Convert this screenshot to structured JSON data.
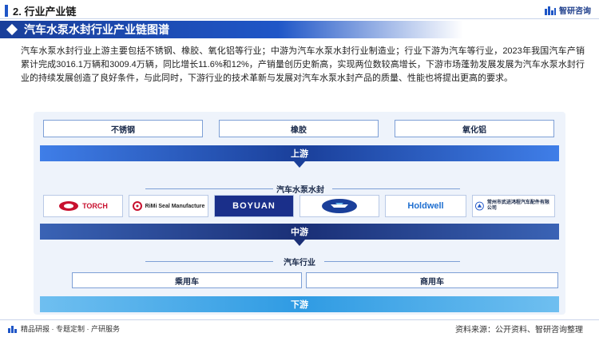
{
  "header": {
    "section": "2. 行业产业链",
    "brand": "智研咨询"
  },
  "title": "汽车水泵水封行业产业链图谱",
  "intro": "汽车水泵水封行业上游主要包括不锈钢、橡胶、氧化铝等行业；中游为汽车水泵水封行业制造业；行业下游为汽车等行业，2023年我国汽车产销累计完成3016.1万辆和3009.4万辆，同比增长11.6%和12%，产销量创历史新高，实现两位数较高增长，下游市场蓬勃发展发展为汽车水泵水封行业的持续发展创造了良好条件，与此同时，下游行业的技术革新与发展对汽车水泵水封产品的质量、性能也将提出更高的要求。",
  "upstream": {
    "materials": [
      "不锈钢",
      "橡胶",
      "氧化铝"
    ],
    "stage_label": "上游"
  },
  "midstream": {
    "sub_label": "汽车水泵水封",
    "companies": [
      {
        "text": "TORCH",
        "color": "#c8102e"
      },
      {
        "text": "RiMi Seal Manufacture",
        "color": "#222222"
      },
      {
        "text": "BOYUAN",
        "color": "#ffffff"
      },
      {
        "text": "",
        "color": "#1f56c7"
      },
      {
        "text": "Holdwell",
        "color": "#1f6fd0"
      },
      {
        "text": "常州市武进鸿程汽车配件有限公司",
        "color": "#1a2a4a"
      }
    ],
    "stage_label": "中游"
  },
  "downstream": {
    "sub_label": "汽车行业",
    "industries": [
      "乘用车",
      "商用车"
    ],
    "stage_label": "下游"
  },
  "footer": {
    "tags": "精品研报 · 专题定制 · 产研服务",
    "source": "资料来源：公开资料、智研咨询整理"
  },
  "colors": {
    "primary": "#1f56c7",
    "dark": "#1a3f9a",
    "light_bg": "#eef3fb",
    "downstream": "#2f9be3"
  }
}
